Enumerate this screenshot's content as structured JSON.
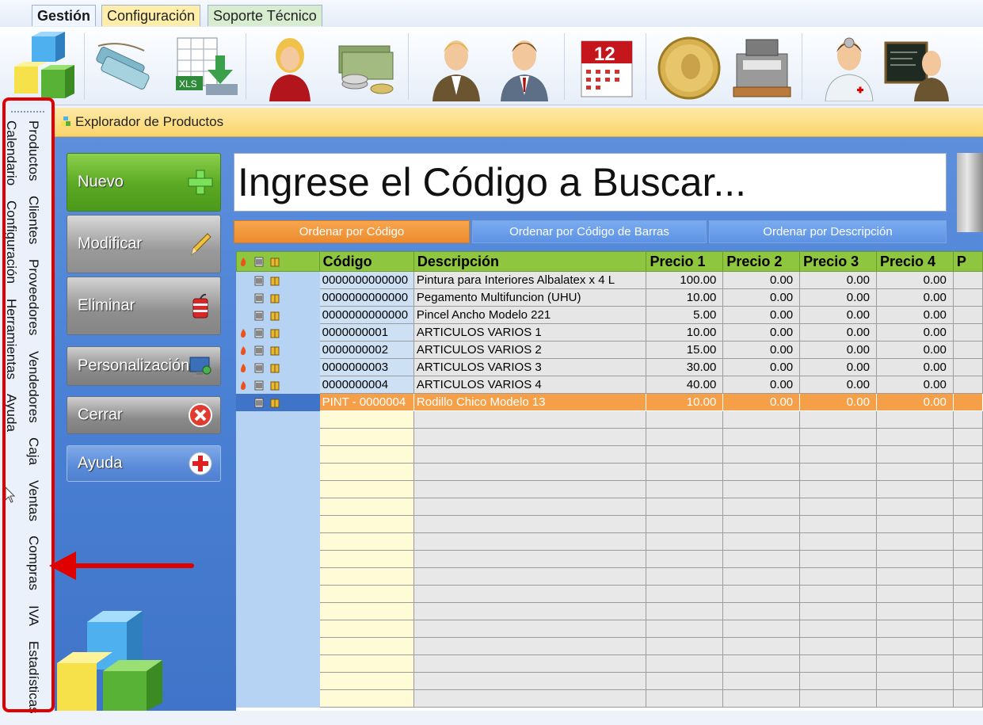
{
  "menu": {
    "tabs": [
      "Gestión",
      "Configuración",
      "Soporte Técnico"
    ]
  },
  "ribbon": {
    "icons": [
      "cubes-icon",
      "tags-icon",
      "excel-export-icon",
      "woman-user-icon",
      "money-icon",
      "man-user-icon",
      "man-user-2-icon",
      "calendar-icon",
      "gold-coin-icon",
      "cash-register-icon",
      "doctor-icon",
      "teacher-icon"
    ],
    "calendar_day": "12"
  },
  "explorer": {
    "title": "Explorador de Productos"
  },
  "sidenav": {
    "column1": [
      "Productos",
      "Clientes",
      "Proveedores",
      "Vendedores",
      "Caja",
      "Ventas",
      "Compras",
      "IVA",
      "Estadísticas"
    ],
    "column2": [
      "Calendario",
      "Configuración",
      "Herramientas",
      "Ayuda"
    ]
  },
  "actions": {
    "nuevo": "Nuevo",
    "modificar": "Modificar",
    "eliminar": "Eliminar",
    "personalizacion": "Personalización",
    "cerrar": "Cerrar",
    "ayuda": "Ayuda"
  },
  "search": {
    "placeholder": "Ingrese el Código a Buscar..."
  },
  "sort": {
    "by_code": "Ordenar por Código",
    "by_barcode": "Ordenar por Código de Barras",
    "by_description": "Ordenar por Descripción"
  },
  "grid": {
    "columns": [
      "Código",
      "Descripción",
      "Precio 1",
      "Precio 2",
      "Precio 3",
      "Precio 4",
      "P"
    ],
    "rows": [
      {
        "codigo": "0000000000000",
        "descripcion": "Pintura para Interiores Albalatex x 4 L",
        "p1": "100.00",
        "p2": "0.00",
        "p3": "0.00",
        "p4": "0.00",
        "flame": false
      },
      {
        "codigo": "0000000000000",
        "descripcion": "Pegamento Multifuncion (UHU)",
        "p1": "10.00",
        "p2": "0.00",
        "p3": "0.00",
        "p4": "0.00",
        "flame": false
      },
      {
        "codigo": "0000000000000",
        "descripcion": "Pincel Ancho Modelo 221",
        "p1": "5.00",
        "p2": "0.00",
        "p3": "0.00",
        "p4": "0.00",
        "flame": false
      },
      {
        "codigo": "0000000001",
        "descripcion": "ARTICULOS VARIOS 1",
        "p1": "10.00",
        "p2": "0.00",
        "p3": "0.00",
        "p4": "0.00",
        "flame": true
      },
      {
        "codigo": "0000000002",
        "descripcion": "ARTICULOS VARIOS 2",
        "p1": "15.00",
        "p2": "0.00",
        "p3": "0.00",
        "p4": "0.00",
        "flame": true
      },
      {
        "codigo": "0000000003",
        "descripcion": "ARTICULOS VARIOS 3",
        "p1": "30.00",
        "p2": "0.00",
        "p3": "0.00",
        "p4": "0.00",
        "flame": true
      },
      {
        "codigo": "0000000004",
        "descripcion": "ARTICULOS VARIOS 4",
        "p1": "40.00",
        "p2": "0.00",
        "p3": "0.00",
        "p4": "0.00",
        "flame": true
      },
      {
        "codigo": "PINT - 0000004",
        "descripcion": "Rodillo Chico Modelo 13",
        "p1": "10.00",
        "p2": "0.00",
        "p3": "0.00",
        "p4": "0.00",
        "flame": false,
        "selected": true
      }
    ],
    "empty_rows": 17
  },
  "colors": {
    "accent_orange": "#f5a048",
    "header_green": "#8ec63f",
    "workspace_blue": "#4c82d6",
    "highlight_red": "#e00000"
  }
}
